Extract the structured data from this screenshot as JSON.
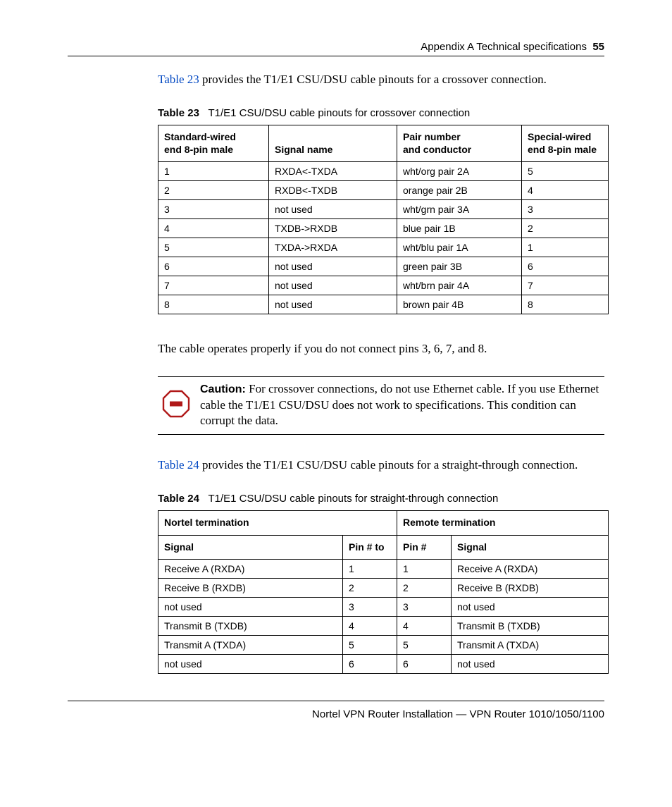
{
  "header": {
    "section": "Appendix A  Technical specifications",
    "page": "55"
  },
  "para1": {
    "link": "Table 23",
    "rest": " provides the T1/E1 CSU/DSU cable pinouts for a crossover connection."
  },
  "table23": {
    "caption_label": "Table 23",
    "caption_title": "T1/E1 CSU/DSU cable pinouts for crossover connection",
    "headers": {
      "c1a": "Standard-wired",
      "c1b": "end 8-pin male",
      "c2": "Signal name",
      "c3a": "Pair number",
      "c3b": "and conductor",
      "c4a": "Special-wired",
      "c4b": "end 8-pin male"
    },
    "rows": [
      {
        "c1": "1",
        "c2": "RXDA<-TXDA",
        "c3": "wht/org pair 2A",
        "c4": "5"
      },
      {
        "c1": "2",
        "c2": "RXDB<-TXDB",
        "c3": "orange pair 2B",
        "c4": "4"
      },
      {
        "c1": "3",
        "c2": "not used",
        "c3": "wht/grn pair 3A",
        "c4": "3"
      },
      {
        "c1": "4",
        "c2": "TXDB->RXDB",
        "c3": "blue pair 1B",
        "c4": "2"
      },
      {
        "c1": "5",
        "c2": "TXDA->RXDA",
        "c3": "wht/blu pair 1A",
        "c4": "1"
      },
      {
        "c1": "6",
        "c2": "not used",
        "c3": "green pair 3B",
        "c4": "6"
      },
      {
        "c1": "7",
        "c2": "not used",
        "c3": "wht/brn pair 4A",
        "c4": "7"
      },
      {
        "c1": "8",
        "c2": "not used",
        "c3": "brown pair 4B",
        "c4": "8"
      }
    ]
  },
  "para2": "The cable operates properly if you do not connect pins 3, 6, 7, and 8.",
  "caution": {
    "label": "Caution:",
    "text": " For crossover connections, do not use Ethernet cable. If you use Ethernet cable the T1/E1 CSU/DSU does not work to specifications. This condition can corrupt the data."
  },
  "para3": {
    "link": "Table 24",
    "rest": " provides the T1/E1 CSU/DSU cable pinouts for a straight-through connection."
  },
  "table24": {
    "caption_label": "Table 24",
    "caption_title": "T1/E1 CSU/DSU cable pinouts for straight-through connection",
    "headers": {
      "span1": "Nortel termination",
      "span2": "Remote termination",
      "s1": "Signal",
      "pa": "Pin #",
      "to": "to",
      "pb": "Pin #",
      "s2": "Signal"
    },
    "rows": [
      {
        "s1": "Receive A (RXDA)",
        "pa": "1",
        "pb": "1",
        "s2": "Receive A (RXDA)"
      },
      {
        "s1": "Receive B (RXDB)",
        "pa": "2",
        "pb": "2",
        "s2": "Receive B (RXDB)"
      },
      {
        "s1": "not used",
        "pa": "3",
        "pb": "3",
        "s2": "not used"
      },
      {
        "s1": "Transmit B (TXDB)",
        "pa": "4",
        "pb": "4",
        "s2": "Transmit B (TXDB)"
      },
      {
        "s1": "Transmit A (TXDA)",
        "pa": "5",
        "pb": "5",
        "s2": "Transmit A (TXDA)"
      },
      {
        "s1": "not used",
        "pa": "6",
        "pb": "6",
        "s2": "not used"
      }
    ]
  },
  "footer": "Nortel VPN Router Installation — VPN Router 1010/1050/1100"
}
